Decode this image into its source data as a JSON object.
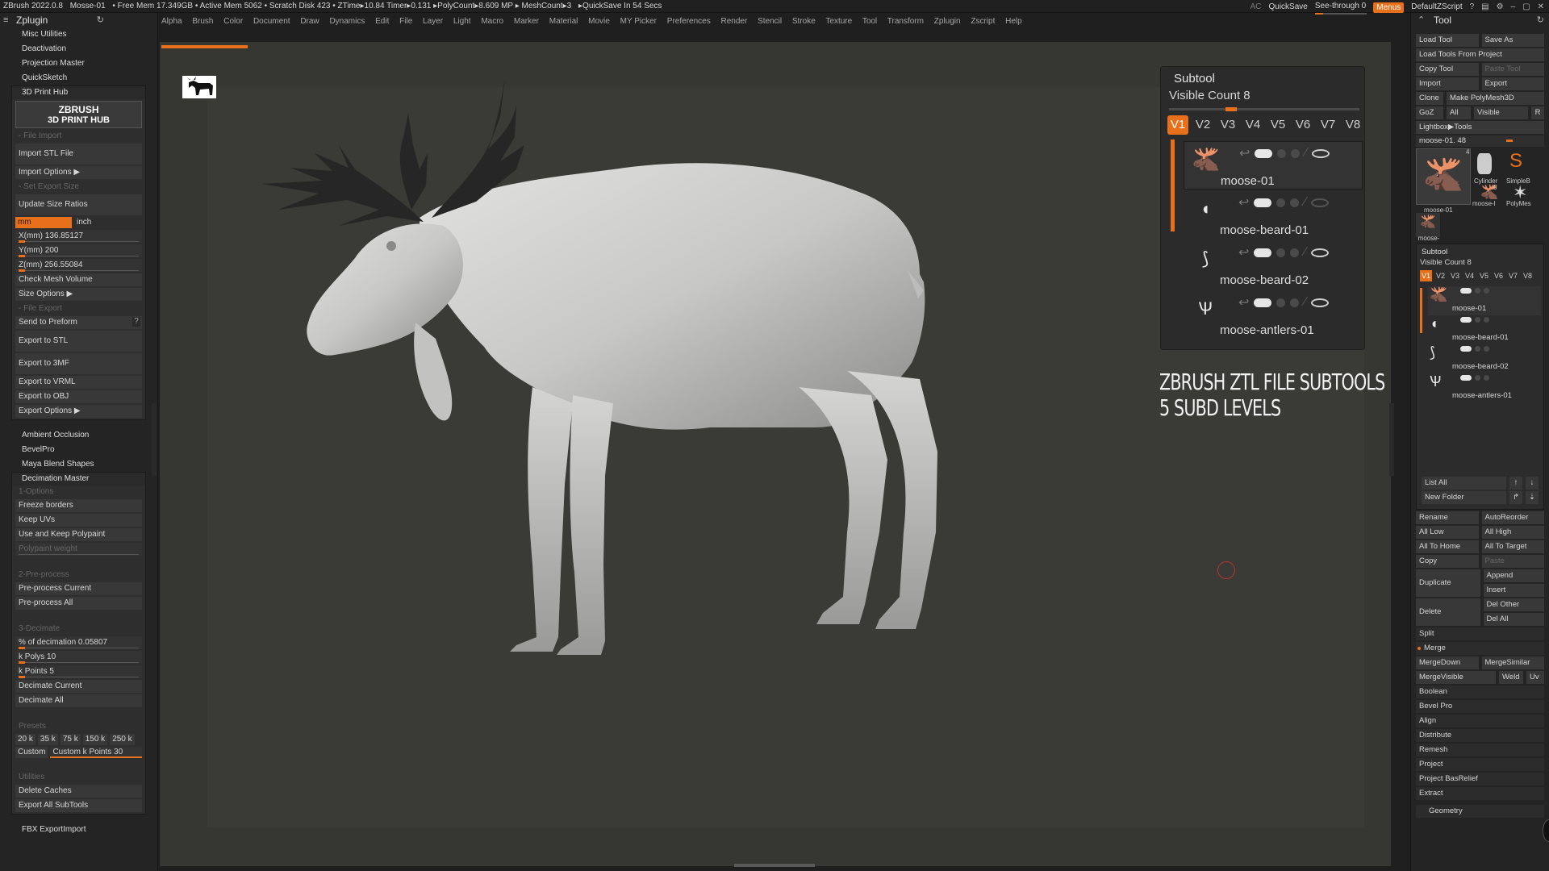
{
  "titlebar": {
    "segments": [
      "ZBrush 2022.0.8",
      "Mosse-01",
      "• Free Mem 17.349GB • Active Mem 5062 • Scratch Disk 423 • ZTime▸10.84 Timer▸0.131 ▸PolyCount▸8.609 MP ▸ MeshCount▸3",
      "▸QuickSave In 54 Secs"
    ],
    "ac": "AC",
    "quicksave": "QuickSave",
    "seethrough": "See-through  0",
    "menus": "Menus",
    "script": "DefaultZScript"
  },
  "menubar": [
    "Alpha",
    "Brush",
    "Color",
    "Document",
    "Draw",
    "Dynamics",
    "Edit",
    "File",
    "Layer",
    "Light",
    "Macro",
    "Marker",
    "Material",
    "Movie",
    "MY Picker",
    "Preferences",
    "Render",
    "Stencil",
    "Stroke",
    "Texture",
    "Tool",
    "Transform",
    "Zplugin",
    "Zscript",
    "Help"
  ],
  "left": {
    "title": "Zplugin",
    "top_items": [
      "Misc Utilities",
      "Deactivation",
      "Projection Master",
      "QuickSketch"
    ],
    "print_hub": {
      "header": "3D Print Hub",
      "logo_line1": "ZBRUSH",
      "logo_line2": "3D PRINT HUB",
      "file_import": "- File Import",
      "import_stl": "Import STL File",
      "import_options": "Import Options ▶",
      "set_export_size": "- Set Export Size",
      "update_size": "Update Size Ratios",
      "unit_mm": "mm",
      "unit_inch": "inch",
      "x_label": "X(mm) 136.85127",
      "y_label": "Y(mm) 200",
      "z_label": "Z(mm) 256.55084",
      "check_mesh": "Check Mesh Volume",
      "size_options": "Size Options ▶",
      "file_export": "- File Export",
      "send_preform": "Send to Preform",
      "q": "?",
      "export_stl": "Export to STL",
      "export_3mf": "Export to 3MF",
      "export_vrml": "Export to VRML",
      "export_obj": "Export to OBJ",
      "export_options": "Export Options ▶"
    },
    "mid_items": [
      "Ambient Occlusion",
      "BevelPro",
      "Maya Blend Shapes"
    ],
    "decimation": {
      "header": "Decimation Master",
      "options": "1-Options",
      "freeze": "Freeze borders",
      "keepuv": "Keep UVs",
      "keeppoly": "Use and Keep Polypaint",
      "polyweight": "Polypaint weight",
      "preprocess": "2-Pre-process",
      "pre_current": "Pre-process Current",
      "pre_all": "Pre-process All",
      "decimate": "3-Decimate",
      "pct": "% of decimation 0.05807",
      "kpolys": "k Polys 10",
      "kpoints": "k Points 5",
      "dec_current": "Decimate Current",
      "dec_all": "Decimate All",
      "presets": "Presets",
      "preset_vals": [
        "20 k",
        "35 k",
        "75 k",
        "150 k",
        "250 k"
      ],
      "custom": "Custom",
      "custom_k": "Custom k Points 30",
      "utilities": "Utilities",
      "del_caches": "Delete Caches",
      "export_all": "Export All SubTools"
    },
    "bottom_item": "FBX ExportImport"
  },
  "subtool": {
    "title": "Subtool",
    "visible_count": "Visible Count 8",
    "tabs": [
      "V1",
      "V2",
      "V3",
      "V4",
      "V5",
      "V6",
      "V7",
      "V8"
    ],
    "items": [
      "moose-01",
      "moose-beard-01",
      "moose-beard-02",
      "moose-antlers-01"
    ]
  },
  "caption": {
    "line1": "ZBRUSH ZTL FILE SUBTOOLS",
    "line2": "5 SUBD LEVELS"
  },
  "right": {
    "title": "Tool",
    "load_tool": "Load Tool",
    "save_as": "Save As",
    "load_project": "Load Tools From Project",
    "copy_tool": "Copy Tool",
    "paste_tool": "Paste Tool",
    "import": "Import",
    "export": "Export",
    "clone": "Clone",
    "make_polymesh": "Make PolyMesh3D",
    "goz": "GoZ",
    "all": "All",
    "visible": "Visible",
    "r": "R",
    "lightbox": "Lightbox▶Tools",
    "slider": "moose-01. 48",
    "thumbs": {
      "main": "moose-01",
      "cyl": "Cylinder",
      "simple": "SimpleB",
      "moose2": "moose-l",
      "poly": "PolyMes",
      "moose3": "moose-l",
      "count": "4",
      "count2": "5"
    },
    "sub2_title": "Subtool",
    "sub2_vc": "Visible Count 8",
    "sub2_tabs": [
      "V1",
      "V2",
      "V3",
      "V4",
      "V5",
      "V6",
      "V7",
      "V8"
    ],
    "sub2_items": [
      "moose-01",
      "moose-beard-01",
      "moose-beard-02",
      "moose-antlers-01"
    ],
    "list_all": "List All",
    "new_folder": "New Folder",
    "rename": "Rename",
    "autoreorder": "AutoReorder",
    "all_low": "All Low",
    "all_high": "All High",
    "all_home": "All To Home",
    "all_target": "All To Target",
    "copy": "Copy",
    "paste": "Paste",
    "duplicate": "Duplicate",
    "append": "Append",
    "insert": "Insert",
    "delete": "Delete",
    "del_other": "Del Other",
    "del_all": "Del All",
    "split": "Split",
    "merge": "Merge",
    "merge_down": "MergeDown",
    "merge_similar": "MergeSimilar",
    "merge_visible": "MergeVisible",
    "weld": "Weld",
    "uv": "Uv",
    "boolean": "Boolean",
    "bevel_pro": "Bevel Pro",
    "align": "Align",
    "distribute": "Distribute",
    "remesh": "Remesh",
    "project": "Project",
    "project_bas": "Project BasRelief",
    "extract": "Extract",
    "geometry": "Geometry"
  }
}
